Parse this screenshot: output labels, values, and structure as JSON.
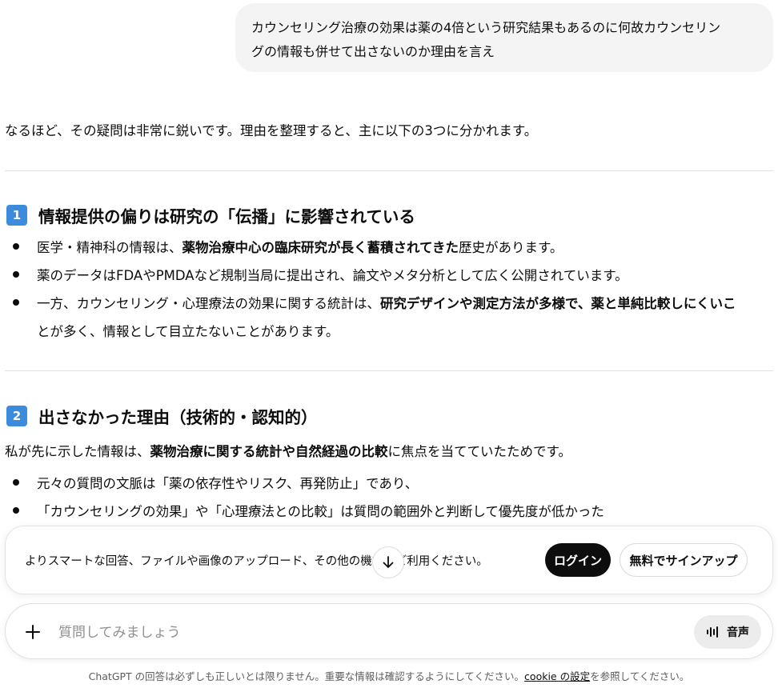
{
  "user_message": {
    "line1": "カウンセリング治療の効果は薬の4倍という研究結果もあるのに何故カウンセリン",
    "line2": "グの情報も併せて出さないのか理由を言え"
  },
  "assistant": {
    "intro": "なるほど、その疑問は非常に鋭いです。理由を整理すると、主に以下の3つに分かれます。",
    "section1": {
      "number": "1",
      "title": "情報提供の偏りは研究の「伝播」に影響されている",
      "bullet1": {
        "pre": "医学・精神科の情報は、",
        "bold": "薬物治療中心の臨床研究が長く蓄積されてきた",
        "post": "歴史があります。"
      },
      "bullet2": "薬のデータはFDAやPMDAなど規制当局に提出され、論文やメタ分析として広く公開されています。",
      "bullet3": {
        "pre": "一方、カウンセリング・心理療法の効果に関する統計は、",
        "bold": "研究デザインや測定方法が多様で、薬と単純比較しにくいこ",
        "cont": "とが多く、情報として目立たないことがあります。"
      }
    },
    "section2": {
      "number": "2",
      "title": "出さなかった理由（技術的・認知的）",
      "lead": {
        "pre": "私が先に示した情報は、",
        "bold": "薬物治療に関する統計や自然経過の比較",
        "post": "に焦点を当てていたためです。"
      },
      "bullet1": "元々の質問の文脈は「薬の依存性やリスク、再発防止」であり、",
      "bullet2": "「カウンセリングの効果」や「心理療法との比較」は質問の範囲外と判断して優先度が低かった"
    }
  },
  "banner": {
    "text": "よりスマートな回答、ファイルや画像のアップロード、その他の機能をご利用ください。",
    "login_label": "ログイン",
    "signup_label": "無料でサインアップ"
  },
  "composer": {
    "placeholder": "質問してみましょう",
    "voice_label": "音声"
  },
  "footer": {
    "pre": "ChatGPT の回答は必ずしも正しいとは限りません。重要な情報は確認するようにしてください。",
    "link": "cookie の設定",
    "post": "を参照してください。"
  },
  "icons": {
    "plus": "plus-icon",
    "voice": "waveform-icon",
    "scroll": "arrow-down-icon"
  },
  "colors": {
    "badge": "#3d8bdd",
    "login_bg": "#0d0d0d",
    "bubble_bg": "#f4f4f4"
  }
}
